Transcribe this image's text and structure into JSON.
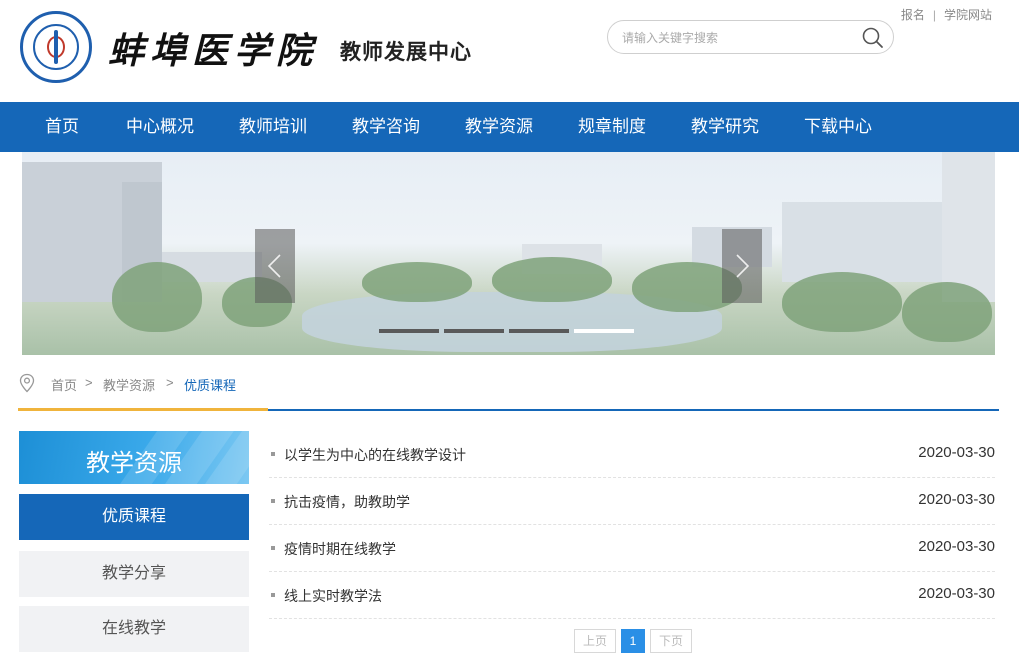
{
  "header": {
    "school_name": "蚌埠医学院",
    "center_name": "教师发展中心",
    "logo_ring_text": "Bengbu Medical College",
    "top_links": [
      "报名",
      "学院网站"
    ],
    "search_placeholder": "请输入关键字搜索"
  },
  "nav": {
    "items": [
      "首页",
      "中心概况",
      "教师培训",
      "教学咨询",
      "教学资源",
      "规章制度",
      "教学研究",
      "下载中心"
    ]
  },
  "banner": {
    "slide_count": 4,
    "active_slide": 4
  },
  "breadcrumb": {
    "items": [
      "首页",
      "教学资源",
      "优质课程"
    ],
    "separator": ">"
  },
  "sidebar": {
    "heading": "教学资源",
    "items": [
      {
        "label": "优质课程",
        "active": true
      },
      {
        "label": "教学分享",
        "active": false
      },
      {
        "label": "在线教学",
        "active": false
      }
    ]
  },
  "articles": [
    {
      "title": "以学生为中心的在线教学设计",
      "date": "2020-03-30"
    },
    {
      "title": "抗击疫情，助教助学",
      "date": "2020-03-30"
    },
    {
      "title": "疫情时期在线教学",
      "date": "2020-03-30"
    },
    {
      "title": "线上实时教学法",
      "date": "2020-03-30"
    }
  ],
  "pager": {
    "prev_label": "上页",
    "current_page": "1",
    "next_label": "下页"
  },
  "colors": {
    "nav_blue": "#1567b8",
    "accent_gold": "#f0b43c",
    "page_button_blue": "#2a8fe6"
  }
}
